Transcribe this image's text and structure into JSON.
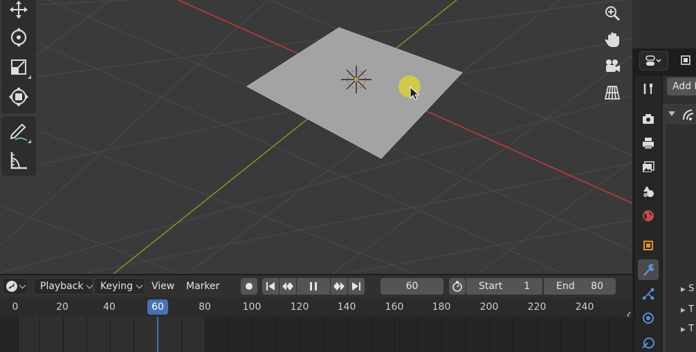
{
  "viewport": {
    "left_tools": [
      "move-tool",
      "rotate-tool",
      "scale-tool",
      "transform-tool",
      "annotate-tool",
      "measure-tool"
    ],
    "nav_gizmos": [
      "zoom-icon",
      "hand-pan-icon",
      "camera-view-icon",
      "perspective-grid-icon"
    ]
  },
  "props": {
    "add_modifier_label": "Add M",
    "tree_items": [
      "S",
      "T",
      "T"
    ]
  },
  "timeline": {
    "editor_icon": "clock-icon",
    "menus": [
      "Playback",
      "Keying",
      "View",
      "Marker"
    ],
    "current_frame": "60",
    "start_label": "Start",
    "start_value": "1",
    "end_label": "End",
    "end_value": "80",
    "ruler_ticks": [
      "0",
      "20",
      "40",
      "60",
      "80",
      "100",
      "120",
      "140",
      "160",
      "180",
      "200",
      "220",
      "240"
    ],
    "indicator_value": "60"
  },
  "colors": {
    "x_axis": "#c13a3a",
    "y_axis": "#6e9a2c",
    "accent": "#4772b3",
    "plane": "#a3a3a3",
    "cursor_highlight": "#d8d040"
  }
}
